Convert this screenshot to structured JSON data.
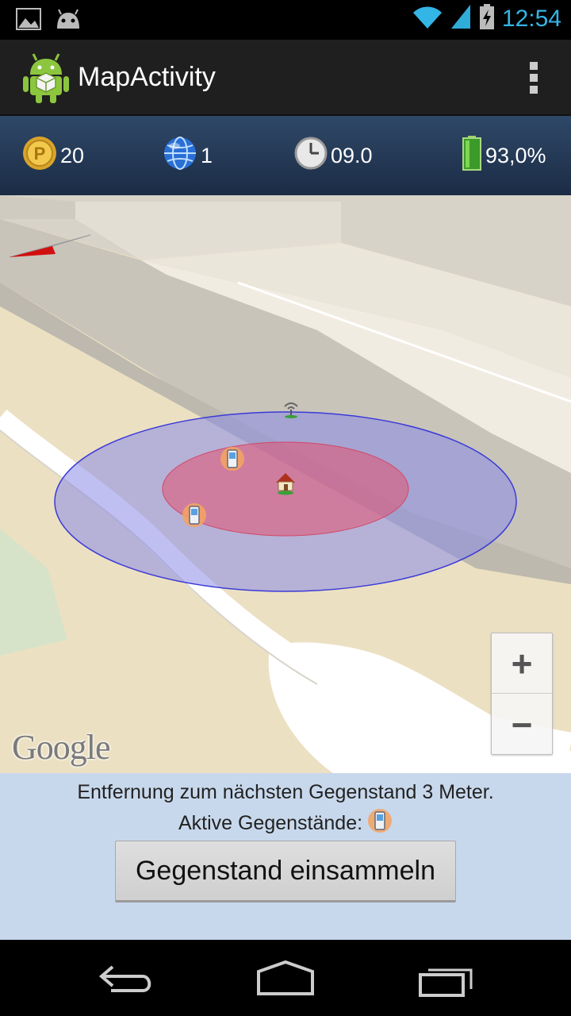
{
  "status_bar": {
    "time": "12:54",
    "icons": [
      "gallery-notification-icon",
      "android-notification-icon",
      "wifi-icon",
      "signal-icon",
      "battery-charging-icon"
    ]
  },
  "action_bar": {
    "title": "MapActivity",
    "icons": [
      "app-logo-icon",
      "overflow-menu-icon"
    ]
  },
  "stats": {
    "points": "20",
    "world": "1",
    "time": "09.0",
    "battery": "93,0%",
    "icons": [
      "coin-icon",
      "globe-icon",
      "clock-icon",
      "battery-icon"
    ]
  },
  "map": {
    "attribution": "Google",
    "zoom_in_label": "+",
    "zoom_out_label": "−",
    "markers": [
      "phone-marker-icon",
      "phone-marker-icon",
      "home-marker-icon",
      "antenna-marker-icon",
      "compass-arrow-icon"
    ],
    "colors": {
      "outer_circle": "#8080e0",
      "inner_circle": "#e05a78",
      "road": "#ffffff",
      "building": "#d7d2c6"
    }
  },
  "info": {
    "distance_text": "Entfernung zum nächsten Gegenstand 3 Meter.",
    "active_items_label": "Aktive Gegenstände:",
    "collect_button": "Gegenstand einsammeln"
  },
  "nav": {
    "icons": [
      "back-icon",
      "home-icon",
      "recent-apps-icon"
    ]
  }
}
